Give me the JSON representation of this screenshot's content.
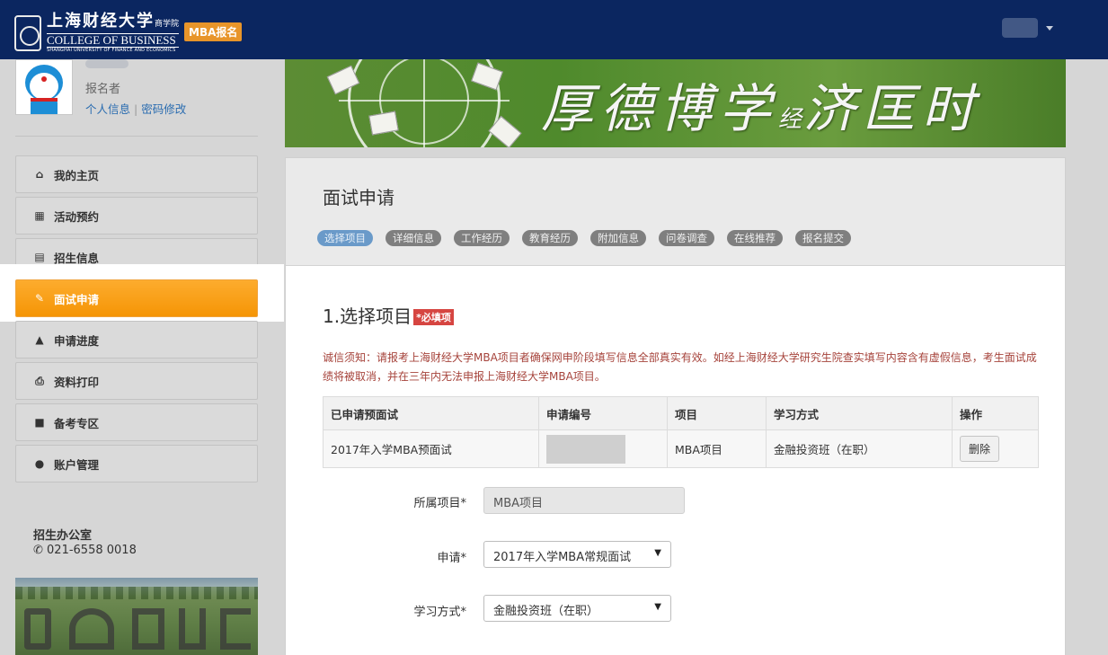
{
  "header": {
    "logo_cn": "上海财经大学",
    "logo_cn_suffix": "商学院",
    "logo_en": "COLLEGE OF BUSINESS",
    "logo_sub": "SHANGHAI UNIVERSITY OF FINANCE AND ECONOMICS",
    "tag": "MBA报名"
  },
  "profile": {
    "role": "报名者",
    "link_info": "个人信息",
    "link_sep": "|",
    "link_password": "密码修改"
  },
  "sidebar": {
    "items": [
      {
        "label": "我的主页",
        "icon": "home-icon"
      },
      {
        "label": "活动预约",
        "icon": "calendar-icon"
      },
      {
        "label": "招生信息",
        "icon": "book-icon"
      },
      {
        "label": "面试申请",
        "icon": "edit-icon",
        "active": true
      },
      {
        "label": "申请进度",
        "icon": "road-icon"
      },
      {
        "label": "资料打印",
        "icon": "print-icon"
      },
      {
        "label": "备考专区",
        "icon": "lock-icon"
      },
      {
        "label": "账户管理",
        "icon": "user-icon"
      }
    ],
    "office_title": "招生办公室",
    "office_phone": "021-6558 0018"
  },
  "banner": {
    "slogan": "厚德博学",
    "slogan_mid": "经",
    "slogan_end": "济匡时"
  },
  "main": {
    "title": "面试申请",
    "steps": [
      "选择项目",
      "详细信息",
      "工作经历",
      "教育经历",
      "附加信息",
      "问卷调查",
      "在线推荐",
      "报名提交"
    ],
    "section_title": "1.选择项目",
    "required_tag": "*必填项",
    "notice": "诚信须知：请报考上海财经大学MBA项目者确保网申阶段填写信息全部真实有效。如经上海财经大学研究生院查实填写内容含有虚假信息，考生面试成绩将被取消，并在三年内无法申报上海财经大学MBA项目。",
    "table": {
      "headers": [
        "已申请预面试",
        "申请编号",
        "项目",
        "学习方式",
        "操作"
      ],
      "row": {
        "interview": "2017年入学MBA预面试",
        "program": "MBA项目",
        "study_mode": "金融投资班（在职）",
        "action": "删除"
      }
    },
    "form": {
      "program_label": "所属项目*",
      "program_value": "MBA项目",
      "apply_label": "申请*",
      "apply_value": "2017年入学MBA常规面试",
      "mode_label": "学习方式*",
      "mode_value": "金融投资班（在职）"
    }
  },
  "colors": {
    "topbar": "#0b2660",
    "active_nav": "#f7a01c",
    "step_current": "#6a9ac9",
    "required": "#d64541",
    "notice": "#a6433b"
  }
}
